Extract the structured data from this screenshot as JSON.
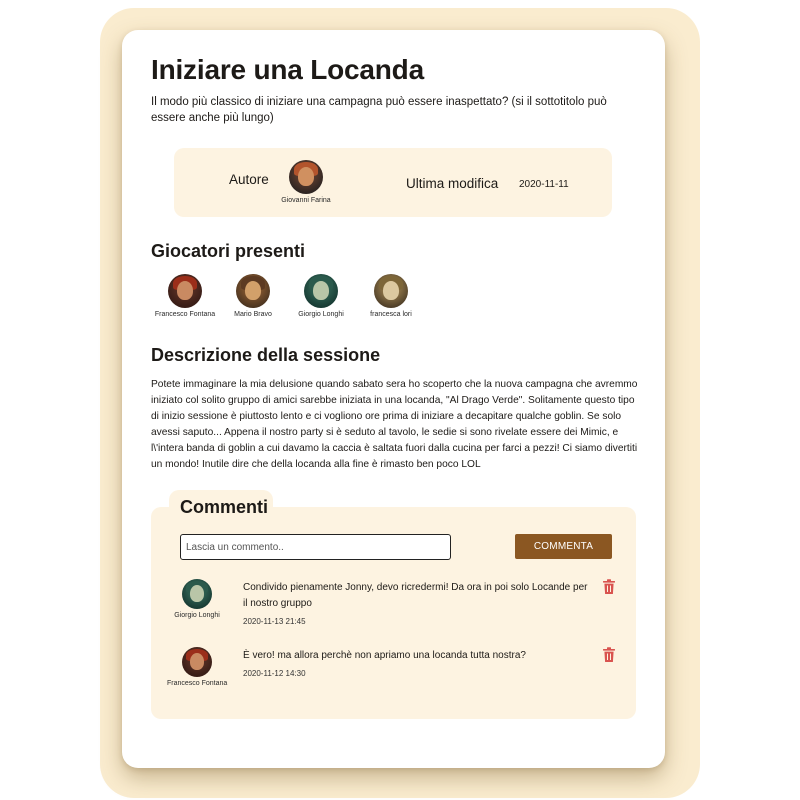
{
  "page": {
    "title": "Iniziare una Locanda",
    "subtitle": "Il modo più classico di iniziare una campagna può essere inaspettato? (si il sottotitolo può essere anche più lungo)"
  },
  "meta": {
    "author_label": "Autore",
    "author_name": "Giovanni Farina",
    "modified_label": "Ultima modifica",
    "modified_date": "2020-11-11"
  },
  "players": {
    "title": "Giocatori presenti",
    "list": [
      {
        "name": "Francesco Fontana",
        "avatar": "avatar-red-hair"
      },
      {
        "name": "Mario Bravo",
        "avatar": "avatar-brown"
      },
      {
        "name": "Giorgio Longhi",
        "avatar": "avatar-green-hood"
      },
      {
        "name": "francesca lori",
        "avatar": "avatar-blonde"
      }
    ]
  },
  "description": {
    "title": "Descrizione della sessione",
    "text": "Potete immaginare la mia delusione quando sabato sera ho scoperto che la nuova campagna che avremmo iniziato col solito gruppo di amici sarebbe iniziata in una locanda, \"Al Drago Verde\". Solitamente questo tipo di inizio sessione è piuttosto lento e ci vogliono ore prima di iniziare a decapitare qualche goblin. Se solo avessi saputo... Appena il nostro party si è seduto al tavolo, le sedie si sono rivelate essere dei Mimic, e l\\'intera banda di goblin a cui davamo la caccia è saltata fuori dalla cucina per farci a pezzi! Ci siamo divertiti un mondo! Inutile dire che della locanda alla fine è rimasto ben poco LOL"
  },
  "comments": {
    "title": "Commenti",
    "input_placeholder": "Lascia un commento..",
    "button_label": "COMMENTA",
    "items": [
      {
        "author": "Giorgio Longhi",
        "text": "Condivido pienamente Jonny, devo ricredermi! Da ora in poi solo Locande per il nostro gruppo",
        "date": "2020-11-13 21:45"
      },
      {
        "author": "Francesco Fontana",
        "text": "È vero! ma allora perchè non apriamo una locanda tutta nostra?",
        "date": "2020-11-12 14:30"
      }
    ]
  },
  "colors": {
    "background_frame": "#faeccf",
    "panel": "#fdf3e1",
    "button": "#8b5722",
    "trash": "#d9534f"
  }
}
